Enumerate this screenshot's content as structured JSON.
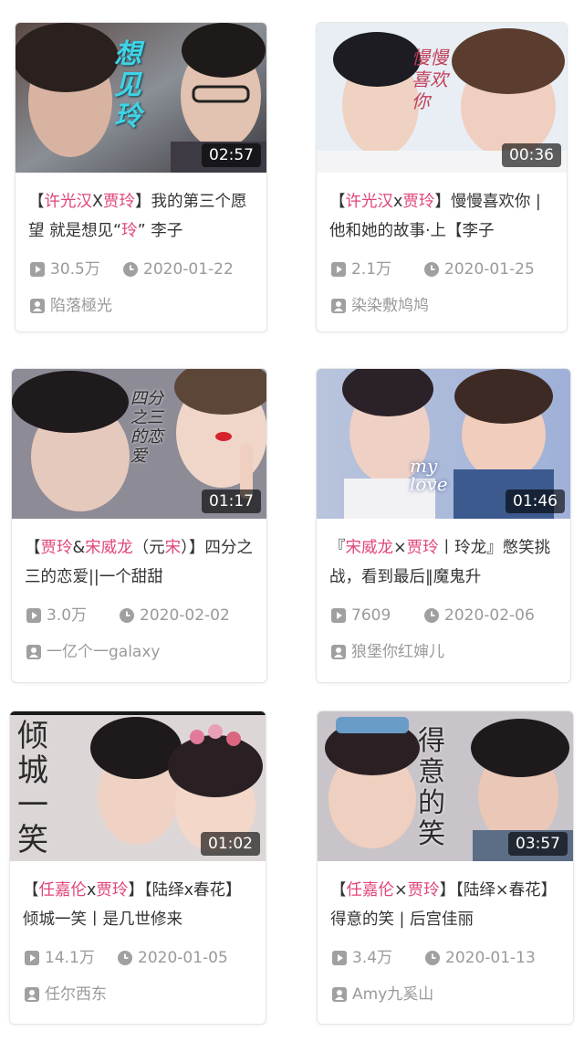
{
  "cards": [
    {
      "title_parts": [
        {
          "t": "【",
          "hl": false
        },
        {
          "t": "许光汉",
          "hl": true
        },
        {
          "t": "X",
          "hl": false
        },
        {
          "t": "贾玲",
          "hl": true
        },
        {
          "t": "】我的第三个愿望 就是想见“",
          "hl": false
        },
        {
          "t": "玲",
          "hl": true
        },
        {
          "t": "” 李子",
          "hl": false
        }
      ],
      "duration": "02:57",
      "views": "30.5万",
      "date": "2020-01-22",
      "author": "陷落極光",
      "thumb_text": "想见玲"
    },
    {
      "title_parts": [
        {
          "t": "【",
          "hl": false
        },
        {
          "t": "许光汉",
          "hl": true
        },
        {
          "t": "x",
          "hl": false
        },
        {
          "t": "贾玲",
          "hl": true
        },
        {
          "t": "】慢慢喜欢你 | 他和她的故事·上【李子",
          "hl": false
        }
      ],
      "duration": "00:36",
      "views": "2.1万",
      "date": "2020-01-25",
      "author": "染染敷鸠鸠",
      "thumb_text": "慢慢喜欢你"
    },
    {
      "title_parts": [
        {
          "t": "【",
          "hl": false
        },
        {
          "t": "贾玲",
          "hl": true
        },
        {
          "t": "&",
          "hl": false
        },
        {
          "t": "宋威龙",
          "hl": true
        },
        {
          "t": "（元",
          "hl": false
        },
        {
          "t": "宋",
          "hl": true
        },
        {
          "t": "）】四分之三的恋爱||一个甜甜",
          "hl": false
        }
      ],
      "duration": "01:17",
      "views": "3.0万",
      "date": "2020-02-02",
      "author": "一亿个一galaxy",
      "thumb_text": "四分之三的恋爱"
    },
    {
      "title_parts": [
        {
          "t": "『",
          "hl": false
        },
        {
          "t": "宋威龙",
          "hl": true
        },
        {
          "t": "×",
          "hl": false
        },
        {
          "t": "贾玲",
          "hl": true
        },
        {
          "t": "丨玲龙』憋笑挑战，看到最后‖魔鬼升",
          "hl": false
        }
      ],
      "duration": "01:46",
      "views": "7609",
      "date": "2020-02-06",
      "author": "狼堡你红婶儿",
      "thumb_text": "my love"
    },
    {
      "title_parts": [
        {
          "t": "【",
          "hl": false
        },
        {
          "t": "任嘉伦",
          "hl": true
        },
        {
          "t": "x",
          "hl": false
        },
        {
          "t": "贾玲",
          "hl": true
        },
        {
          "t": "】【陆绎x春花】倾城一笑丨是几世修来",
          "hl": false
        }
      ],
      "duration": "01:02",
      "views": "14.1万",
      "date": "2020-01-05",
      "author": "任尔西东",
      "thumb_text": "倾城一笑"
    },
    {
      "title_parts": [
        {
          "t": "【",
          "hl": false
        },
        {
          "t": "任嘉伦",
          "hl": true
        },
        {
          "t": "×",
          "hl": false
        },
        {
          "t": "贾玲",
          "hl": true
        },
        {
          "t": "】【陆绎×春花】得意的笑 | 后宫佳丽",
          "hl": false
        }
      ],
      "duration": "03:57",
      "views": "3.4万",
      "date": "2020-01-13",
      "author": "Amy九奚山",
      "thumb_text": "得意的笑"
    }
  ],
  "icons": {
    "play": "play-count-icon",
    "clock": "clock-icon",
    "user": "uploader-icon"
  },
  "colors": {
    "highlight": "#e0457b",
    "meta": "#9a9a9a",
    "title": "#333333"
  }
}
